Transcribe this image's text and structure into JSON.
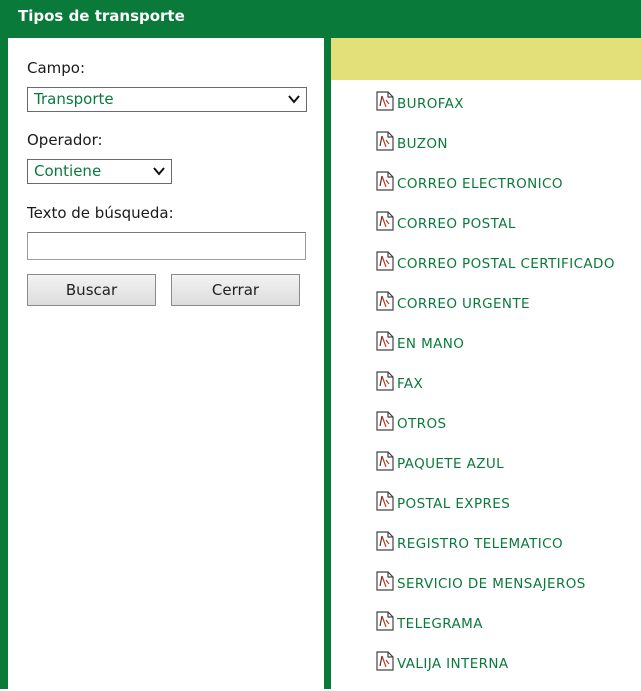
{
  "window": {
    "title": "Tipos de transporte"
  },
  "search": {
    "campo_label": "Campo:",
    "campo_value": "Transporte",
    "operador_label": "Operador:",
    "operador_value": "Contiene",
    "texto_label": "Texto de búsqueda:",
    "texto_value": "",
    "buscar_label": "Buscar",
    "cerrar_label": "Cerrar"
  },
  "results": {
    "items": [
      "BUROFAX",
      "BUZON",
      "CORREO ELECTRONICO",
      "CORREO POSTAL",
      "CORREO POSTAL CERTIFICADO",
      "CORREO URGENTE",
      "EN MANO",
      "FAX",
      "OTROS",
      "PAQUETE AZUL",
      "POSTAL EXPRES",
      "REGISTRO TELEMATICO",
      "SERVICIO DE MENSAJEROS",
      "TELEGRAMA",
      "VALIJA INTERNA"
    ]
  },
  "colors": {
    "accent": "#0a7a3a",
    "header_bar": "#e3e07a",
    "link": "#0a7a3a"
  },
  "icons": {
    "item_icon": "document-icon",
    "dropdown": "chevron-down-icon"
  }
}
